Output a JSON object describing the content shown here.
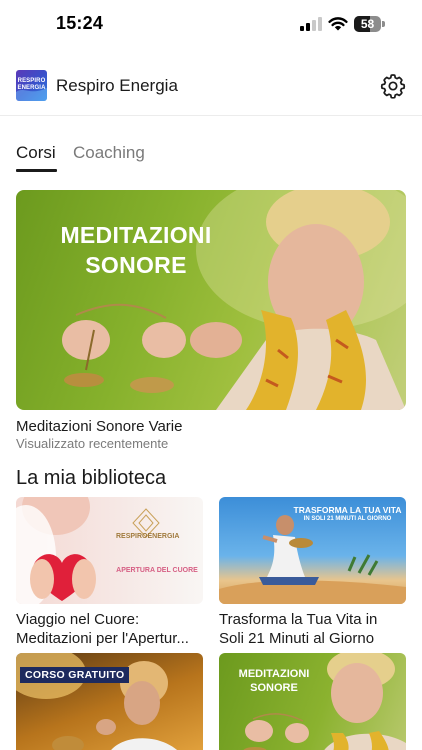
{
  "status_bar": {
    "time": "15:24",
    "battery": "58",
    "battery_level": 0.58
  },
  "header": {
    "logo_text": "RESPIRO ENERGIA",
    "title": "Respiro Energia"
  },
  "tabs": [
    {
      "label": "Corsi",
      "selected": true
    },
    {
      "label": "Coaching",
      "selected": false
    }
  ],
  "featured": {
    "image_title": "MEDITAZIONI SONORE",
    "title": "Meditazioni Sonore Varie",
    "subtitle": "Visualizzato recentemente"
  },
  "library": {
    "title": "La mia biblioteca",
    "items": [
      {
        "title_line1": "Viaggio nel Cuore:",
        "title_line2": "Meditazioni per l'Apertur...",
        "image_logo": "RESPIROENERGIA",
        "image_text": "APERTURA DEL CUORE"
      },
      {
        "title_line1": "Trasforma la Tua Vita in",
        "title_line2": "Soli 21 Minuti al Giorno",
        "image_title": "TRASFORMA LA TUA VITA",
        "image_subtitle": "IN SOLI 21 MINUTI AL GIORNO"
      },
      {
        "badge": "CORSO GRATUITO"
      },
      {
        "image_title": "MEDITAZIONI SONORE"
      }
    ]
  },
  "colors": {
    "accent": "#1b1b1b",
    "inactive_tab": "#7a7a7a",
    "brand_blue": "#3a4fc9"
  }
}
